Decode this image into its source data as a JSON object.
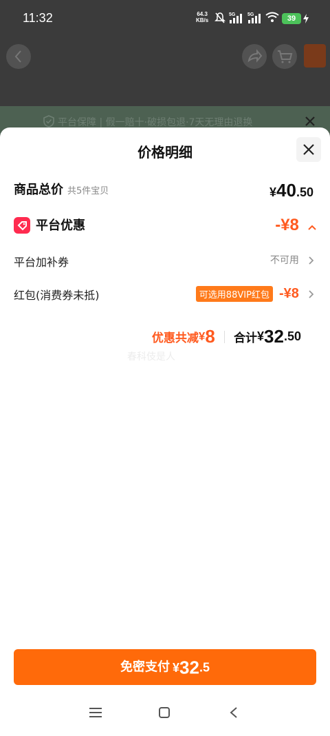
{
  "status": {
    "time": "11:32",
    "net_speed": "64.3",
    "net_unit": "KB/s",
    "battery": "39",
    "signal_label_1": "5G",
    "signal_label_2": "5G"
  },
  "background": {
    "banner": "平台保障 | 假一赔十·破损包退·7天无理由退换"
  },
  "sheet": {
    "title": "价格明细",
    "total": {
      "label": "商品总价",
      "sub": "共5件宝贝",
      "currency": "¥",
      "int": "40",
      "dec": ".50"
    },
    "platform_discount": {
      "label": "平台优惠",
      "amount": "-¥8"
    },
    "coupon": {
      "label": "平台加补券",
      "status": "不可用"
    },
    "redpacket": {
      "label": "红包(消费券未抵)",
      "badge": "可选用88VIP红包",
      "amount": "-¥8"
    },
    "summary": {
      "saved_label": "优惠共减",
      "saved_currency": "¥",
      "saved_value": "8",
      "total_label": "合计",
      "total_currency": "¥",
      "total_int": "32",
      "total_dec": ".50"
    },
    "faint_text": "春科伎是人"
  },
  "pay_button": {
    "label": "免密支付",
    "currency": "¥",
    "int": "32",
    "dec": ".5"
  },
  "colors": {
    "accent": "#ff6a0a",
    "discount": "#ff5a1f",
    "tag": "#ff2b4f"
  }
}
